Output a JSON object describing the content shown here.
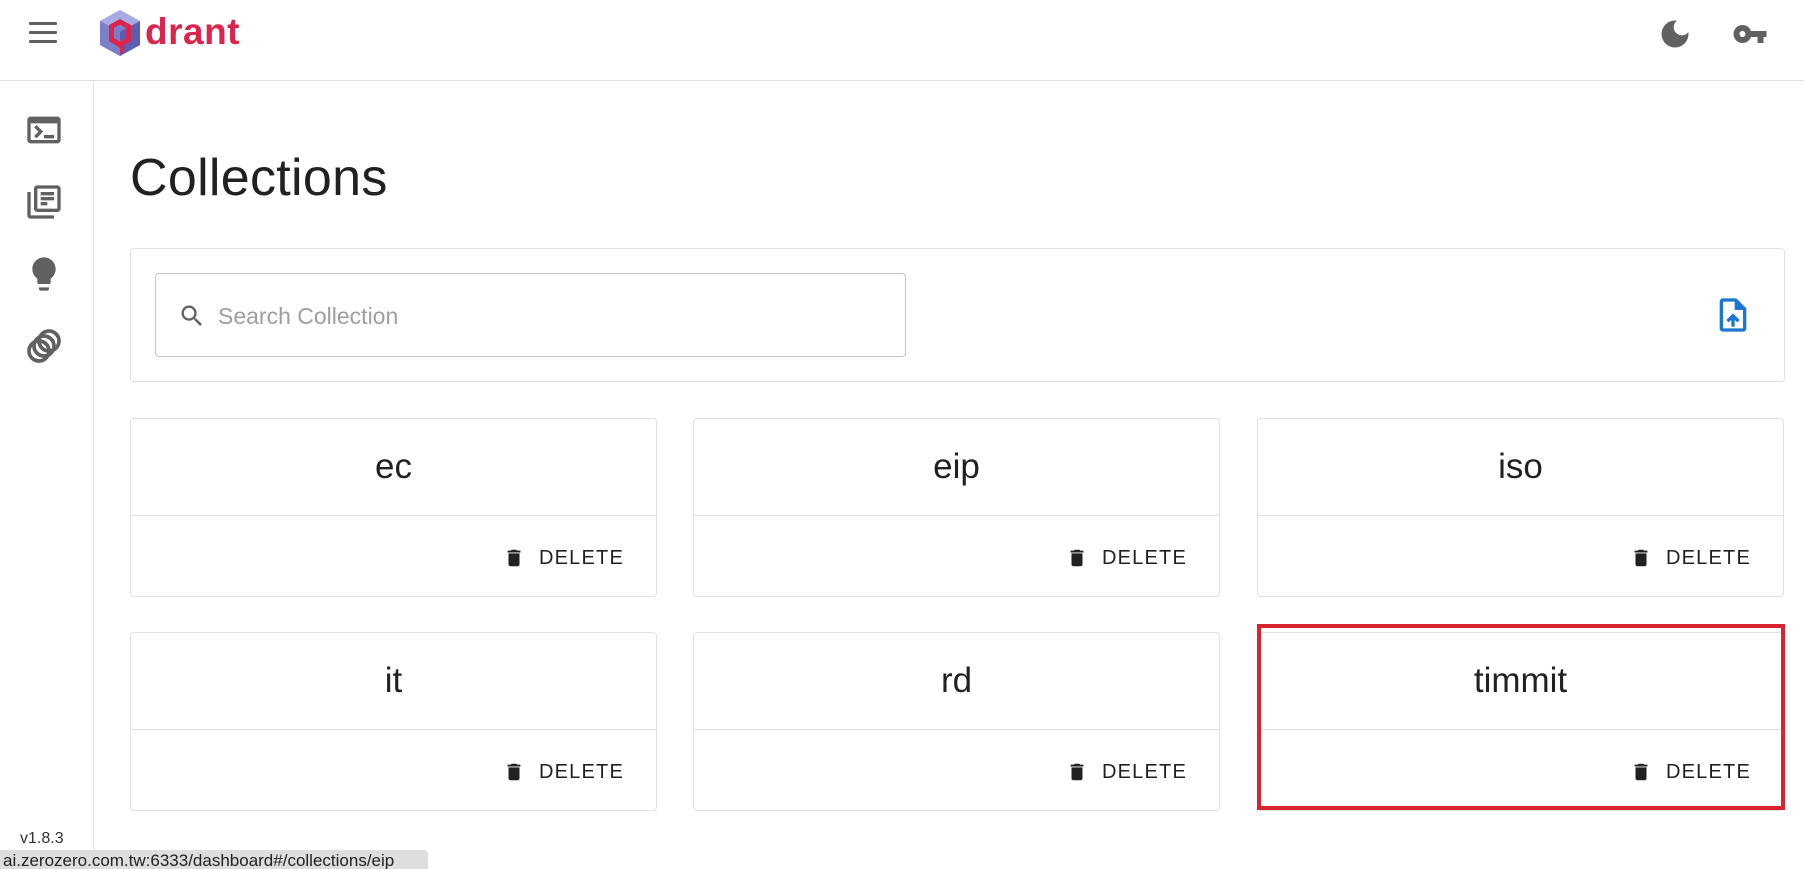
{
  "app": {
    "logo_text": "drant",
    "brand_color": "#dc244c",
    "accent_color": "#1976d2"
  },
  "appbar": {
    "menu_icon": "menu-icon",
    "theme_icon": "dark-mode-moon-icon",
    "key_icon": "api-key-icon"
  },
  "sidebar": {
    "items": [
      {
        "icon": "console-icon"
      },
      {
        "icon": "collections-library-icon"
      },
      {
        "icon": "tutorial-lightbulb-icon"
      },
      {
        "icon": "datasets-icon"
      }
    ],
    "version": "v1.8.3"
  },
  "page": {
    "title": "Collections"
  },
  "search": {
    "placeholder": "Search Collection",
    "value": "",
    "upload_icon": "upload-snapshot-icon"
  },
  "collections": [
    {
      "name": "ec",
      "delete_label": "DELETE"
    },
    {
      "name": "eip",
      "delete_label": "DELETE"
    },
    {
      "name": "iso",
      "delete_label": "DELETE"
    },
    {
      "name": "it",
      "delete_label": "DELETE"
    },
    {
      "name": "rd",
      "delete_label": "DELETE"
    },
    {
      "name": "timmit",
      "delete_label": "DELETE"
    }
  ],
  "status_bar": {
    "url": "ai.zerozero.com.tw:6333/dashboard#/collections/eip"
  }
}
